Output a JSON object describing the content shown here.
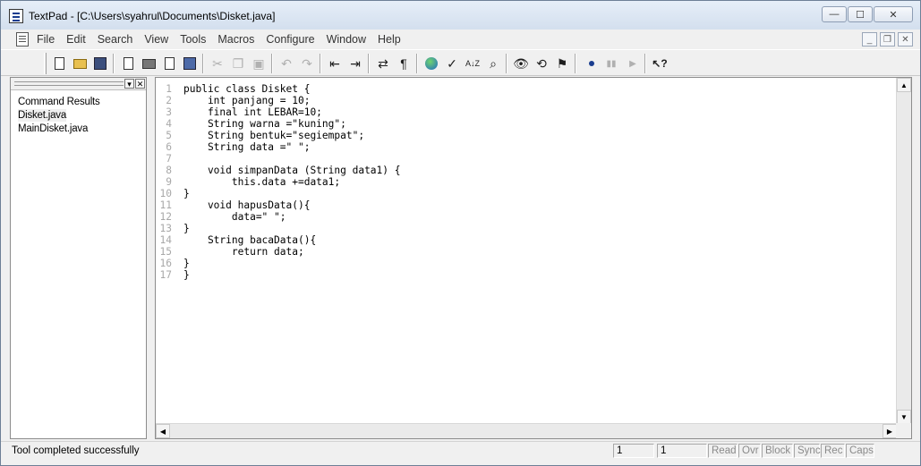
{
  "window": {
    "title": "TextPad - [C:\\Users\\syahrul\\Documents\\Disket.java]",
    "caption_minimize": "—",
    "caption_maximize": "☐",
    "caption_close": "✕"
  },
  "menu": {
    "items": [
      "File",
      "Edit",
      "Search",
      "View",
      "Tools",
      "Macros",
      "Configure",
      "Window",
      "Help"
    ],
    "mdi_minimize": "_",
    "mdi_restore": "❐",
    "mdi_close": "✕"
  },
  "toolbar": {
    "paragraph_glyph": "¶",
    "sort_glyph": "A↓Z",
    "help_glyph": "↖?"
  },
  "left_panel": {
    "dropdown_glyph": "▾",
    "close_glyph": "✕",
    "items": [
      {
        "label": "Command Results",
        "active": false
      },
      {
        "label": "Disket.java",
        "active": true
      },
      {
        "label": "MainDisket.java",
        "active": false
      }
    ]
  },
  "editor": {
    "lines": [
      {
        "n": "1",
        "text": "public class Disket {"
      },
      {
        "n": "2",
        "text": "    int panjang = 10;"
      },
      {
        "n": "3",
        "text": "    final int LEBAR=10;"
      },
      {
        "n": "4",
        "text": "    String warna =\"kuning\";"
      },
      {
        "n": "5",
        "text": "    String bentuk=\"segiempat\";"
      },
      {
        "n": "6",
        "text": "    String data =\" \";"
      },
      {
        "n": "7",
        "text": ""
      },
      {
        "n": "8",
        "text": "    void simpanData (String data1) {"
      },
      {
        "n": "9",
        "text": "        this.data +=data1;"
      },
      {
        "n": "10",
        "text": "}"
      },
      {
        "n": "11",
        "text": "    void hapusData(){"
      },
      {
        "n": "12",
        "text": "        data=\" \";"
      },
      {
        "n": "13",
        "text": "}"
      },
      {
        "n": "14",
        "text": "    String bacaData(){"
      },
      {
        "n": "15",
        "text": "        return data;"
      },
      {
        "n": "16",
        "text": "}"
      },
      {
        "n": "17",
        "text": "}"
      }
    ],
    "scroll_up": "▲",
    "scroll_down": "▼",
    "scroll_left": "◀",
    "scroll_right": "▶"
  },
  "status": {
    "message": "Tool completed successfully",
    "line": "1",
    "column": "1",
    "indicators": [
      "Read",
      "Ovr",
      "Block",
      "Sync",
      "Rec",
      "Caps"
    ]
  }
}
